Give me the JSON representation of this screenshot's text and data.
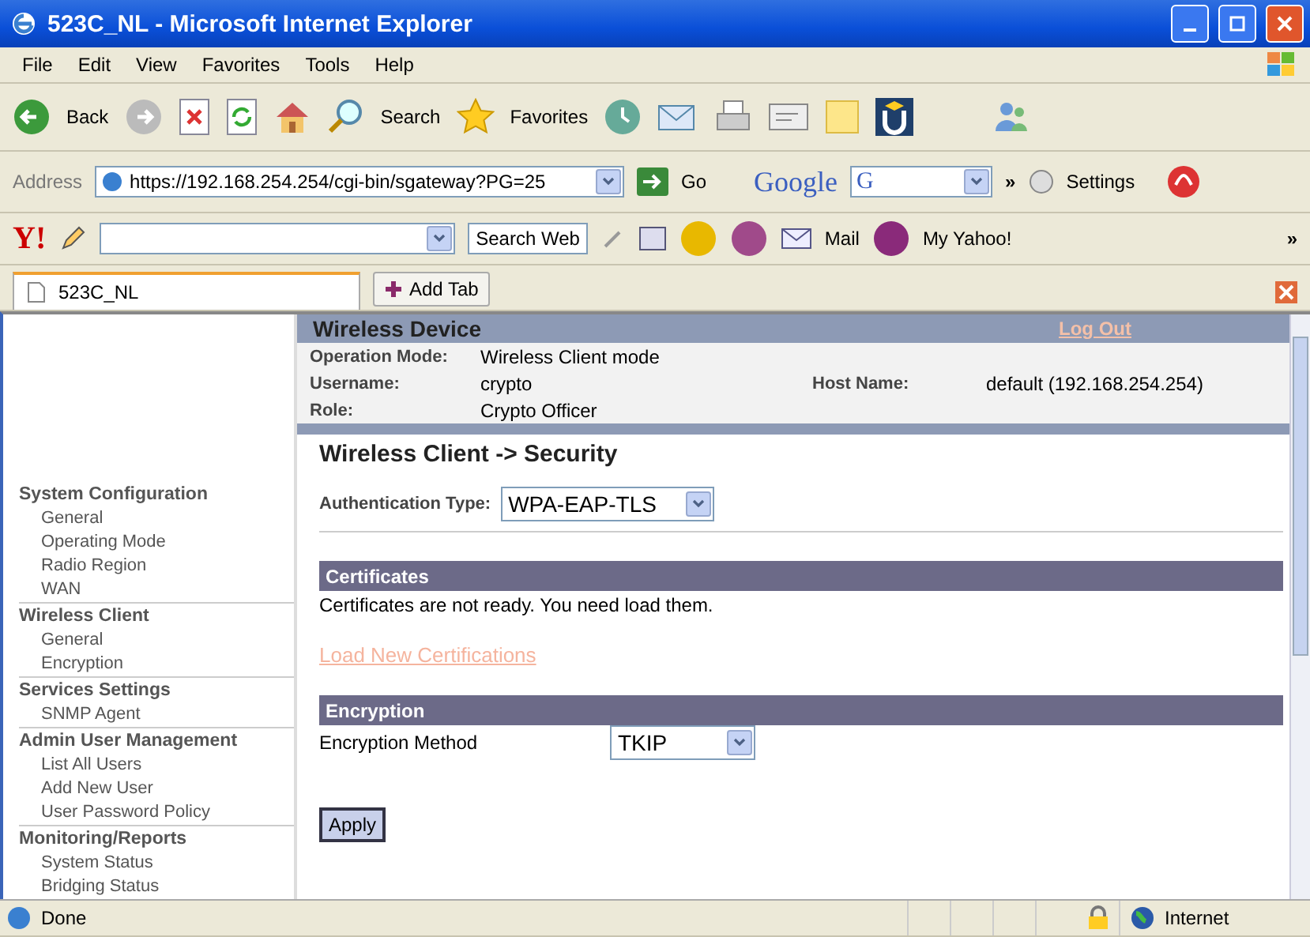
{
  "window": {
    "title": "523C_NL - Microsoft Internet Explorer"
  },
  "menu": [
    "File",
    "Edit",
    "View",
    "Favorites",
    "Tools",
    "Help"
  ],
  "toolbar": {
    "back": "Back",
    "search": "Search",
    "favorites": "Favorites"
  },
  "address_bar": {
    "label": "Address",
    "url": "https://192.168.254.254/cgi-bin/sgateway?PG=25",
    "go": "Go",
    "google": "Google",
    "google_button": "G",
    "more": "»",
    "settings": "Settings"
  },
  "yahoo_bar": {
    "logo": "Y!",
    "search_button": "Search Web",
    "mail": "Mail",
    "my_yahoo": "My Yahoo!",
    "more": "»"
  },
  "tabs": [
    {
      "label": "523C_NL",
      "selected": true
    }
  ],
  "add_tab": "Add Tab",
  "sidebar": [
    {
      "title": "System Configuration",
      "items": [
        "General",
        "Operating Mode",
        "Radio Region",
        "WAN"
      ]
    },
    {
      "title": "Wireless Client",
      "items": [
        "General",
        "Encryption"
      ]
    },
    {
      "title": "Services Settings",
      "items": [
        "SNMP Agent"
      ]
    },
    {
      "title": "Admin User Management",
      "items": [
        "List All Users",
        "Add New User",
        "User Password Policy"
      ]
    },
    {
      "title": "Monitoring/Reports",
      "items": [
        "System Status",
        "Bridging Status"
      ]
    }
  ],
  "device_header": {
    "title": "Wireless Device",
    "logout": "Log Out",
    "fields": [
      {
        "label": "Operation Mode:",
        "value": "Wireless Client mode"
      },
      {
        "label": "Username:",
        "value": "crypto",
        "extra_label": "Host Name:",
        "extra_value": "default (192.168.254.254)"
      },
      {
        "label": "Role:",
        "value": "Crypto Officer"
      }
    ]
  },
  "page_title": "Wireless Client -> Security",
  "authentication": {
    "label": "Authentication Type:",
    "value": "WPA-EAP-TLS"
  },
  "certificates": {
    "heading": "Certificates",
    "message": "Certificates are not ready. You need load them.",
    "link": "Load New Certifications"
  },
  "encryption": {
    "heading": "Encryption",
    "label": "Encryption Method",
    "value": "TKIP"
  },
  "apply": "Apply",
  "status_bar": {
    "text": "Done",
    "zone": "Internet"
  }
}
